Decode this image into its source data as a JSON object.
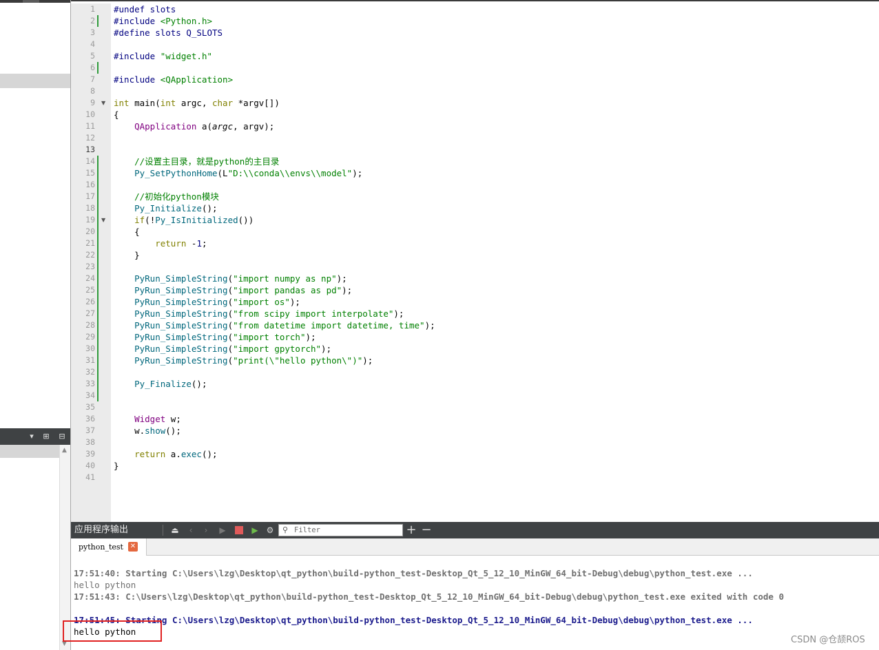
{
  "editor": {
    "lines": [
      {
        "n": "1",
        "mod": false,
        "fold": false,
        "cur": false,
        "parts": [
          [
            "pp",
            "#undef slots"
          ]
        ]
      },
      {
        "n": "2",
        "mod": true,
        "fold": false,
        "cur": false,
        "parts": [
          [
            "pp",
            "#include "
          ],
          [
            "str",
            "<Python.h>"
          ]
        ]
      },
      {
        "n": "3",
        "mod": false,
        "fold": false,
        "cur": false,
        "parts": [
          [
            "pp",
            "#define slots Q_SLOTS"
          ]
        ]
      },
      {
        "n": "4",
        "mod": false,
        "fold": false,
        "cur": false,
        "parts": []
      },
      {
        "n": "5",
        "mod": false,
        "fold": false,
        "cur": false,
        "parts": [
          [
            "pp",
            "#include "
          ],
          [
            "str",
            "\"widget.h\""
          ]
        ]
      },
      {
        "n": "6",
        "mod": true,
        "fold": false,
        "cur": false,
        "parts": []
      },
      {
        "n": "7",
        "mod": false,
        "fold": false,
        "cur": false,
        "parts": [
          [
            "pp",
            "#include "
          ],
          [
            "str",
            "<QApplication>"
          ]
        ]
      },
      {
        "n": "8",
        "mod": false,
        "fold": false,
        "cur": false,
        "parts": []
      },
      {
        "n": "9",
        "mod": false,
        "fold": true,
        "cur": false,
        "parts": [
          [
            "kw",
            "int"
          ],
          [
            "",
            " main("
          ],
          [
            "kw",
            "int"
          ],
          [
            "",
            " argc, "
          ],
          [
            "kw",
            "char"
          ],
          [
            "",
            " *argv[])"
          ]
        ]
      },
      {
        "n": "10",
        "mod": false,
        "fold": false,
        "cur": false,
        "parts": [
          [
            "",
            "{"
          ]
        ]
      },
      {
        "n": "11",
        "mod": false,
        "fold": false,
        "cur": false,
        "parts": [
          [
            "",
            "    "
          ],
          [
            "ty",
            "QApplication"
          ],
          [
            "",
            " a("
          ],
          [
            "it",
            "argc"
          ],
          [
            "",
            ", argv);"
          ]
        ]
      },
      {
        "n": "12",
        "mod": false,
        "fold": false,
        "cur": false,
        "parts": []
      },
      {
        "n": "13",
        "mod": false,
        "fold": false,
        "cur": true,
        "parts": []
      },
      {
        "n": "14",
        "mod": true,
        "fold": false,
        "cur": false,
        "parts": [
          [
            "",
            "    "
          ],
          [
            "cm",
            "//设置主目录，就是python的主目录"
          ]
        ]
      },
      {
        "n": "15",
        "mod": true,
        "fold": false,
        "cur": false,
        "parts": [
          [
            "",
            "    "
          ],
          [
            "fn",
            "Py_SetPythonHome"
          ],
          [
            "",
            "(L"
          ],
          [
            "str",
            "\"D:\\\\conda\\\\envs\\\\model\""
          ],
          [
            "",
            ");"
          ]
        ]
      },
      {
        "n": "16",
        "mod": true,
        "fold": false,
        "cur": false,
        "parts": []
      },
      {
        "n": "17",
        "mod": true,
        "fold": false,
        "cur": false,
        "parts": [
          [
            "",
            "    "
          ],
          [
            "cm",
            "//初始化python模块"
          ]
        ]
      },
      {
        "n": "18",
        "mod": true,
        "fold": false,
        "cur": false,
        "parts": [
          [
            "",
            "    "
          ],
          [
            "fn",
            "Py_Initialize"
          ],
          [
            "",
            "();"
          ]
        ]
      },
      {
        "n": "19",
        "mod": true,
        "fold": true,
        "cur": false,
        "parts": [
          [
            "",
            "    "
          ],
          [
            "kw",
            "if"
          ],
          [
            "",
            "(!"
          ],
          [
            "fn",
            "Py_IsInitialized"
          ],
          [
            "",
            "())"
          ]
        ]
      },
      {
        "n": "20",
        "mod": true,
        "fold": false,
        "cur": false,
        "parts": [
          [
            "",
            "    {"
          ]
        ]
      },
      {
        "n": "21",
        "mod": true,
        "fold": false,
        "cur": false,
        "parts": [
          [
            "",
            "        "
          ],
          [
            "kw",
            "return"
          ],
          [
            "",
            " -"
          ],
          [
            "num",
            "1"
          ],
          [
            "",
            ";"
          ]
        ]
      },
      {
        "n": "22",
        "mod": true,
        "fold": false,
        "cur": false,
        "parts": [
          [
            "",
            "    }"
          ]
        ]
      },
      {
        "n": "23",
        "mod": true,
        "fold": false,
        "cur": false,
        "parts": []
      },
      {
        "n": "24",
        "mod": true,
        "fold": false,
        "cur": false,
        "parts": [
          [
            "",
            "    "
          ],
          [
            "fn",
            "PyRun_SimpleString"
          ],
          [
            "",
            "("
          ],
          [
            "str",
            "\"import numpy as np\""
          ],
          [
            "",
            ");"
          ]
        ]
      },
      {
        "n": "25",
        "mod": true,
        "fold": false,
        "cur": false,
        "parts": [
          [
            "",
            "    "
          ],
          [
            "fn",
            "PyRun_SimpleString"
          ],
          [
            "",
            "("
          ],
          [
            "str",
            "\"import pandas as pd\""
          ],
          [
            "",
            ");"
          ]
        ]
      },
      {
        "n": "26",
        "mod": true,
        "fold": false,
        "cur": false,
        "parts": [
          [
            "",
            "    "
          ],
          [
            "fn",
            "PyRun_SimpleString"
          ],
          [
            "",
            "("
          ],
          [
            "str",
            "\"import os\""
          ],
          [
            "",
            ");"
          ]
        ]
      },
      {
        "n": "27",
        "mod": true,
        "fold": false,
        "cur": false,
        "parts": [
          [
            "",
            "    "
          ],
          [
            "fn",
            "PyRun_SimpleString"
          ],
          [
            "",
            "("
          ],
          [
            "str",
            "\"from scipy import interpolate\""
          ],
          [
            "",
            ");"
          ]
        ]
      },
      {
        "n": "28",
        "mod": true,
        "fold": false,
        "cur": false,
        "parts": [
          [
            "",
            "    "
          ],
          [
            "fn",
            "PyRun_SimpleString"
          ],
          [
            "",
            "("
          ],
          [
            "str",
            "\"from datetime import datetime, time\""
          ],
          [
            "",
            ");"
          ]
        ]
      },
      {
        "n": "29",
        "mod": true,
        "fold": false,
        "cur": false,
        "parts": [
          [
            "",
            "    "
          ],
          [
            "fn",
            "PyRun_SimpleString"
          ],
          [
            "",
            "("
          ],
          [
            "str",
            "\"import torch\""
          ],
          [
            "",
            ");"
          ]
        ]
      },
      {
        "n": "30",
        "mod": true,
        "fold": false,
        "cur": false,
        "parts": [
          [
            "",
            "    "
          ],
          [
            "fn",
            "PyRun_SimpleString"
          ],
          [
            "",
            "("
          ],
          [
            "str",
            "\"import gpytorch\""
          ],
          [
            "",
            ");"
          ]
        ]
      },
      {
        "n": "31",
        "mod": true,
        "fold": false,
        "cur": false,
        "parts": [
          [
            "",
            "    "
          ],
          [
            "fn",
            "PyRun_SimpleString"
          ],
          [
            "",
            "("
          ],
          [
            "str",
            "\"print(\\\"hello python\\\")\""
          ],
          [
            "",
            ");"
          ]
        ]
      },
      {
        "n": "32",
        "mod": true,
        "fold": false,
        "cur": false,
        "parts": []
      },
      {
        "n": "33",
        "mod": true,
        "fold": false,
        "cur": false,
        "parts": [
          [
            "",
            "    "
          ],
          [
            "fn",
            "Py_Finalize"
          ],
          [
            "",
            "();"
          ]
        ]
      },
      {
        "n": "34",
        "mod": true,
        "fold": false,
        "cur": false,
        "parts": []
      },
      {
        "n": "35",
        "mod": false,
        "fold": false,
        "cur": false,
        "parts": []
      },
      {
        "n": "36",
        "mod": false,
        "fold": false,
        "cur": false,
        "parts": [
          [
            "",
            "    "
          ],
          [
            "ty",
            "Widget"
          ],
          [
            "",
            " w;"
          ]
        ]
      },
      {
        "n": "37",
        "mod": false,
        "fold": false,
        "cur": false,
        "parts": [
          [
            "",
            "    w."
          ],
          [
            "fn",
            "show"
          ],
          [
            "",
            "();"
          ]
        ]
      },
      {
        "n": "38",
        "mod": false,
        "fold": false,
        "cur": false,
        "parts": []
      },
      {
        "n": "39",
        "mod": false,
        "fold": false,
        "cur": false,
        "parts": [
          [
            "",
            "    "
          ],
          [
            "kw",
            "return"
          ],
          [
            "",
            " a."
          ],
          [
            "fn",
            "exec"
          ],
          [
            "",
            "();"
          ]
        ]
      },
      {
        "n": "40",
        "mod": false,
        "fold": false,
        "cur": false,
        "parts": [
          [
            "",
            "}"
          ]
        ]
      },
      {
        "n": "41",
        "mod": false,
        "fold": false,
        "cur": false,
        "parts": []
      }
    ]
  },
  "output": {
    "title": "应用程序输出",
    "filter_placeholder": "Filter",
    "tab_label": "python_test",
    "tab_close": "✕",
    "lines": [
      {
        "style": "o-gray",
        "text": "17:51:40: Starting C:\\Users\\lzg\\Desktop\\qt_python\\build-python_test-Desktop_Qt_5_12_10_MinGW_64_bit-Debug\\debug\\python_test.exe ..."
      },
      {
        "style": "o-plain",
        "text": "hello python"
      },
      {
        "style": "o-gray",
        "text": "17:51:43: C:\\Users\\lzg\\Desktop\\qt_python\\build-python_test-Desktop_Qt_5_12_10_MinGW_64_bit-Debug\\debug\\python_test.exe exited with code 0"
      },
      {
        "style": "",
        "text": ""
      },
      {
        "style": "o-blue",
        "text": "17:51:45: Starting C:\\Users\\lzg\\Desktop\\qt_python\\build-python_test-Desktop_Qt_5_12_10_MinGW_64_bit-Debug\\debug\\python_test.exe ..."
      },
      {
        "style": "o-black",
        "text": "hello python"
      }
    ]
  },
  "watermark": "CSDN @仓颉ROS",
  "colors": {
    "modified_marker": "#2e9a3a",
    "highlight_box": "#e02020",
    "toolbar_bg": "#3f4244"
  }
}
